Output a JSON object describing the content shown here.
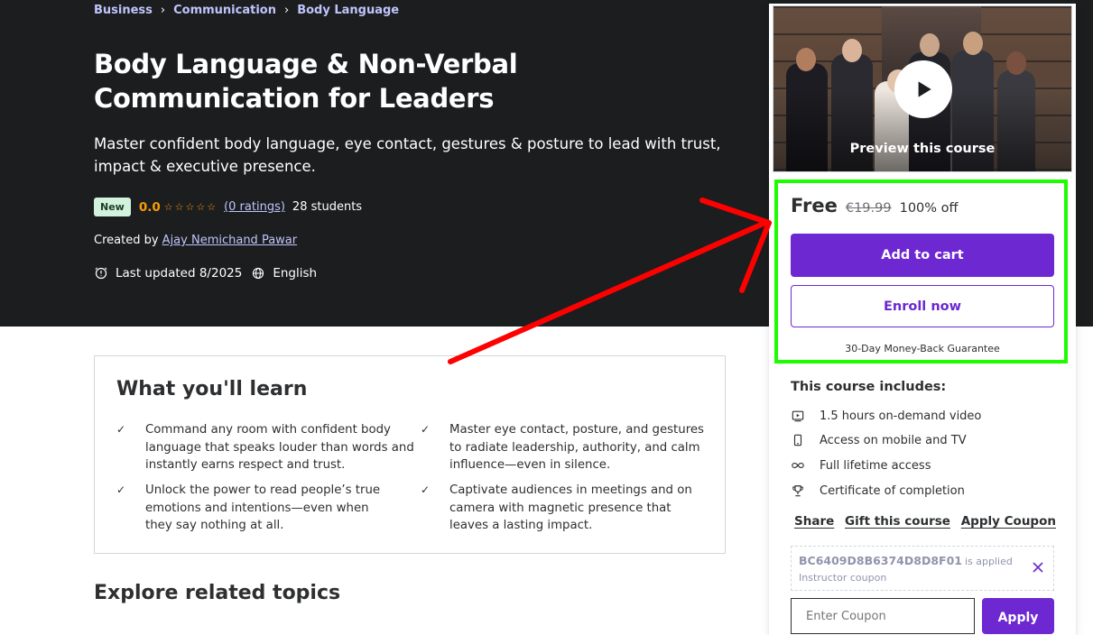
{
  "breadcrumb": [
    "Business",
    "Communication",
    "Body Language"
  ],
  "course": {
    "title": "Body Language & Non-Verbal Communication for Leaders",
    "subtitle": "Master confident body language, eye contact, gestures & posture to lead with trust, impact & executive presence.",
    "badge": "New",
    "rating": "0.0",
    "stars_filled": 0,
    "ratings_link": "(0 ratings)",
    "students": "28 students",
    "created_by_prefix": "Created by",
    "instructor": "Ajay Nemichand Pawar",
    "last_updated": "Last updated 8/2025",
    "language": "English"
  },
  "learn": {
    "heading": "What you'll learn",
    "items": [
      "Command any room with confident body language that speaks louder than words and instantly earns respect and trust.",
      "Master eye contact, posture, and gestures to radiate leadership, authority, and calm influence—even in silence.",
      "Unlock the power to read people’s true emotions and intentions—even when they say nothing at all.",
      "Captivate audiences in meetings and on camera with magnetic presence that leaves a lasting impact."
    ]
  },
  "explore": {
    "heading": "Explore related topics"
  },
  "sidebar": {
    "preview_label": "Preview this course",
    "price": "Free",
    "original_price": "€19.99",
    "discount": "100% off",
    "add_to_cart": "Add to cart",
    "enroll_now": "Enroll now",
    "guarantee": "30-Day Money-Back Guarantee",
    "includes_title": "This course includes:",
    "includes": [
      {
        "icon": "video-icon",
        "label": "1.5 hours on-demand video"
      },
      {
        "icon": "mobile-icon",
        "label": "Access on mobile and TV"
      },
      {
        "icon": "infinity-icon",
        "label": "Full lifetime access"
      },
      {
        "icon": "trophy-icon",
        "label": "Certificate of completion"
      }
    ],
    "share": "Share",
    "gift": "Gift this course",
    "apply_coupon": "Apply Coupon",
    "coupon_code": "BC6409D8B6374D8D8F01",
    "coupon_applied": "is applied",
    "coupon_type": "Instructor coupon",
    "coupon_placeholder": "Enter Coupon",
    "apply_button": "Apply"
  },
  "colors": {
    "hero_bg": "#1c1d1f",
    "link": "#c0c4fc",
    "rating": "#f69c08",
    "brand_purple": "#6d28d2",
    "annotation_green": "#1efc00",
    "annotation_red": "#ff0000"
  }
}
